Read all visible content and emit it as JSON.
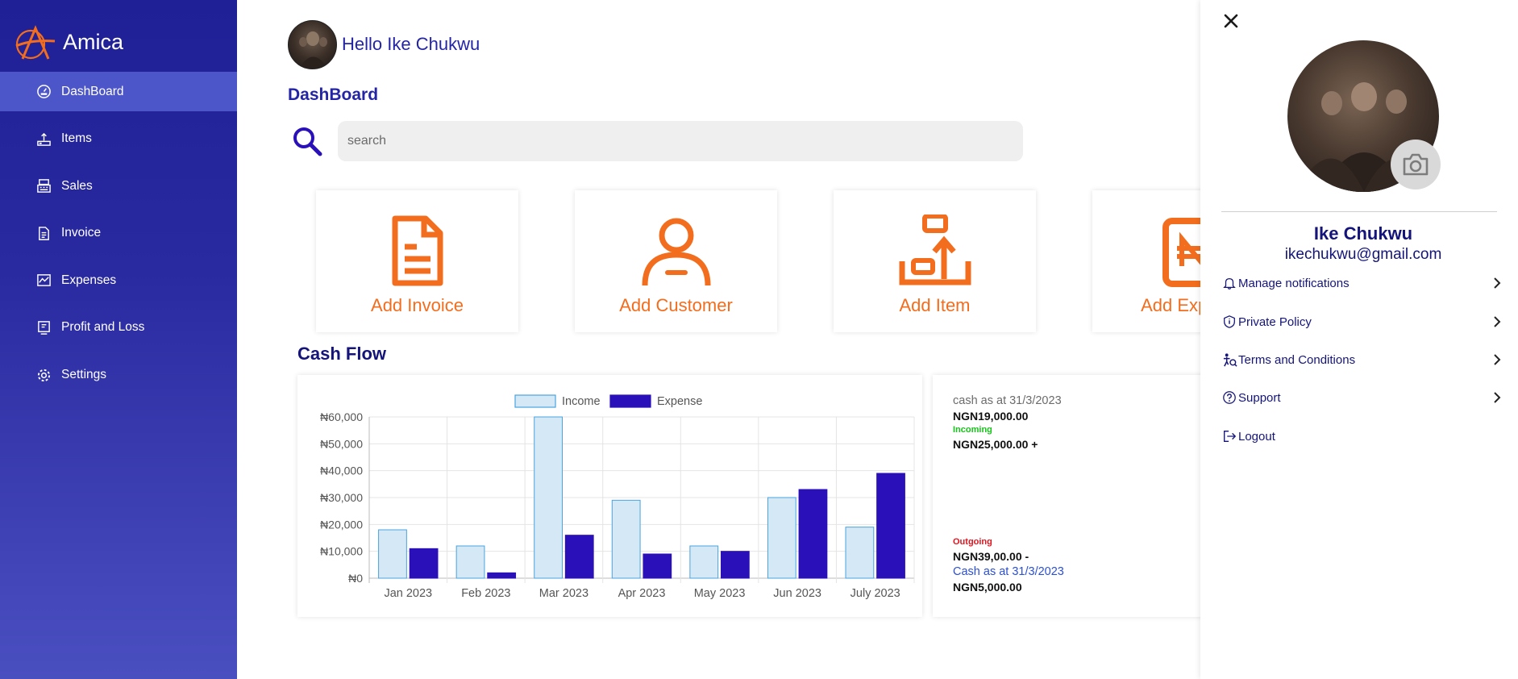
{
  "app": {
    "brand": "Amica"
  },
  "sidebar": {
    "items": [
      {
        "label": "DashBoard",
        "icon": "dashboard-icon",
        "active": true
      },
      {
        "label": "Items",
        "icon": "items-icon"
      },
      {
        "label": "Sales",
        "icon": "cash-register-icon"
      },
      {
        "label": "Invoice",
        "icon": "invoice-icon"
      },
      {
        "label": "Expenses",
        "icon": "expenses-icon"
      },
      {
        "label": "Profit and Loss",
        "icon": "profit-loss-icon"
      },
      {
        "label": "Settings",
        "icon": "gear-icon"
      }
    ]
  },
  "header": {
    "greeting": "Hello Ike Chukwu",
    "page_title": "DashBoard"
  },
  "search": {
    "placeholder": "search"
  },
  "actions": [
    {
      "label": "Add Invoice",
      "icon": "document-icon"
    },
    {
      "label": "Add Customer",
      "icon": "user-icon"
    },
    {
      "label": "Add Item",
      "icon": "upload-box-icon"
    },
    {
      "label": "Add Expense",
      "icon": "naira-icon"
    }
  ],
  "cash_flow": {
    "title": "Cash Flow",
    "summary": {
      "cash_label": "cash as at 31/3/2023",
      "cash_value": "NGN19,000.00",
      "incoming_label": "Incoming",
      "incoming_value": "NGN25,000.00 +",
      "outgoing_label": "Outgoing",
      "outgoing_value": "NGN39,00.00 -",
      "cash_label2": "Cash as at 31/3/2023",
      "cash_value2": "NGN5,000.00"
    }
  },
  "chart_data": {
    "type": "bar",
    "categories": [
      "Jan 2023",
      "Feb 2023",
      "Mar 2023",
      "Apr 2023",
      "May 2023",
      "Jun 2023",
      "July 2023"
    ],
    "series": [
      {
        "name": "Income",
        "values": [
          18000,
          12000,
          60000,
          29000,
          12000,
          30000,
          19000
        ],
        "color": "#d4e8f6",
        "stroke": "#4aa3df"
      },
      {
        "name": "Expense",
        "values": [
          11000,
          2000,
          16000,
          9000,
          10000,
          33000,
          39000
        ],
        "color": "#2a10b8",
        "stroke": "#2a10b8"
      }
    ],
    "ylim": [
      0,
      60000
    ],
    "yticks": [
      "₦0",
      "₦10,000",
      "₦20,000",
      "₦30,000",
      "₦40,000",
      "₦50,000",
      "₦60,000"
    ],
    "legend": "top-center",
    "grid": true
  },
  "profile": {
    "name": "Ike Chukwu",
    "email": "ikechukwu@gmail.com",
    "menu": [
      {
        "label": "Manage notifications",
        "icon": "bell-icon",
        "chevron": true
      },
      {
        "label": "Private Policy",
        "icon": "shield-icon",
        "chevron": true
      },
      {
        "label": "Terms and Conditions",
        "icon": "terms-icon",
        "chevron": true
      },
      {
        "label": "Support",
        "icon": "help-icon",
        "chevron": true
      },
      {
        "label": "Logout",
        "icon": "logout-icon",
        "chevron": false
      }
    ]
  },
  "colors": {
    "primary": "#2424a6",
    "accent": "#f26d1d",
    "sidebar": "#1f1f96",
    "incoming": "#17c21a",
    "outgoing": "#e0141e"
  }
}
